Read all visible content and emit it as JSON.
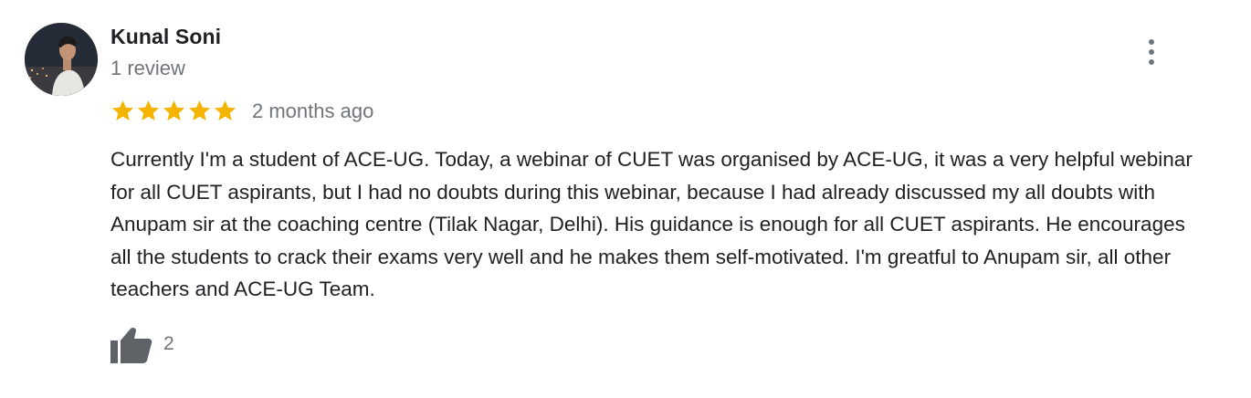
{
  "reviewer": {
    "name": "Kunal Soni",
    "review_count": "1 review",
    "avatar_icon": "profile-photo"
  },
  "rating": {
    "stars": 5,
    "max_stars": 5,
    "star_color": "#f4b400",
    "relative_time": "2 months ago"
  },
  "review": {
    "text": "Currently I'm a student of ACE-UG. Today, a webinar of CUET was organised by ACE-UG, it was a very helpful webinar for all CUET aspirants, but I had no doubts during this webinar, because I had already discussed my all doubts with Anupam sir at the coaching centre (Tilak Nagar, Delhi). His guidance is enough for all CUET aspirants. He encourages all the students to crack their exams very well and he makes them self-motivated. I'm greatful to Anupam sir, all other teachers and ACE-UG Team."
  },
  "actions": {
    "menu_icon": "more-vert-icon",
    "like_icon": "thumbs-up-icon",
    "like_count": "2"
  },
  "colors": {
    "primary_text": "#202124",
    "secondary_text": "#70757a",
    "icon_gray": "#5f6368"
  }
}
